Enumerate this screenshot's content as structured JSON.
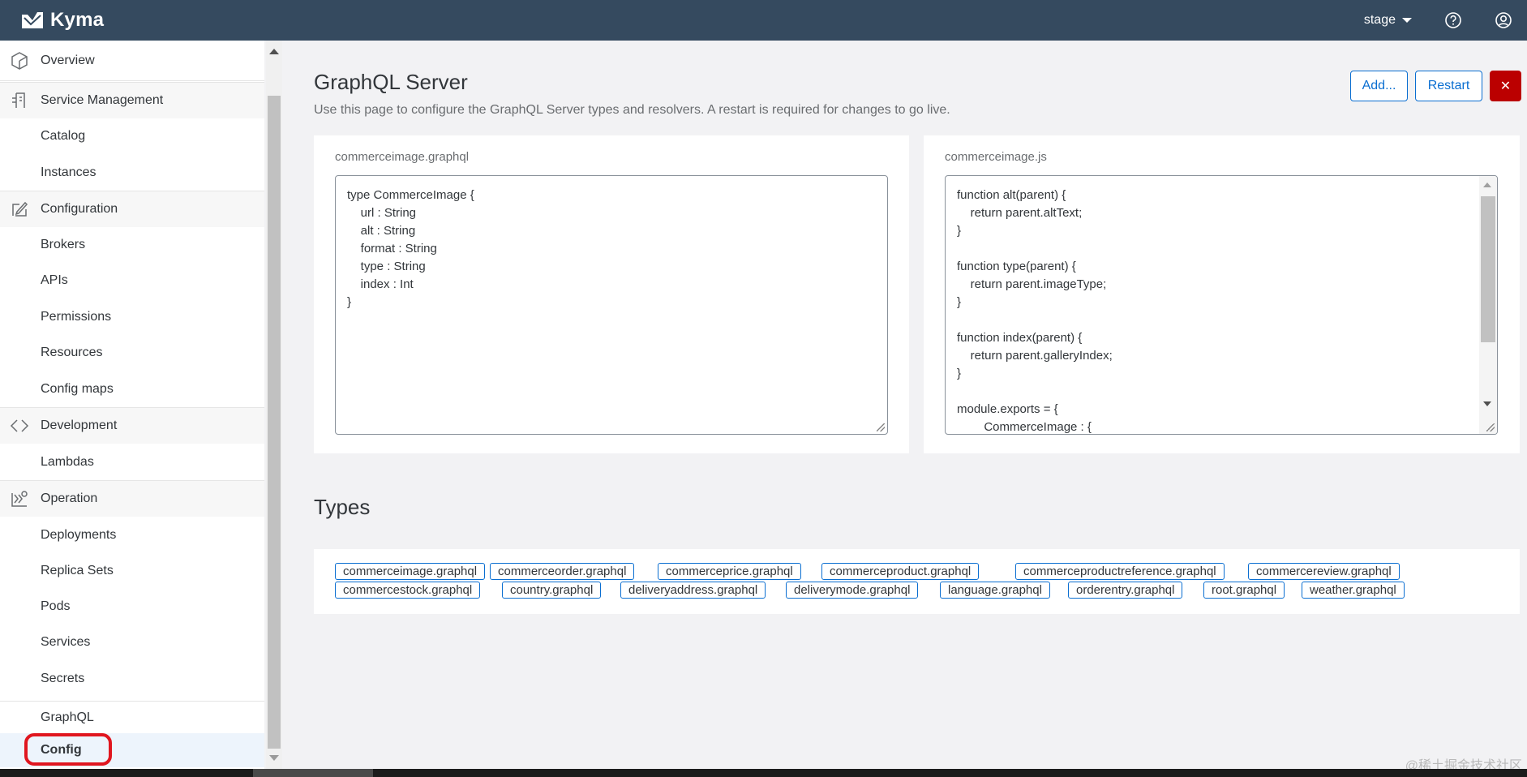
{
  "shell": {
    "app_title": "Kyma",
    "environment": "stage"
  },
  "sidebar": {
    "items": [
      {
        "label": "Overview",
        "kind": "section",
        "icon": "overview-icon"
      },
      {
        "label": "Service Management",
        "kind": "section",
        "icon": "service-management-icon"
      },
      {
        "label": "Catalog",
        "kind": "sub"
      },
      {
        "label": "Instances",
        "kind": "sub"
      },
      {
        "label": "Configuration",
        "kind": "section",
        "icon": "configuration-icon"
      },
      {
        "label": "Brokers",
        "kind": "sub"
      },
      {
        "label": "APIs",
        "kind": "sub"
      },
      {
        "label": "Permissions",
        "kind": "sub"
      },
      {
        "label": "Resources",
        "kind": "sub"
      },
      {
        "label": "Config maps",
        "kind": "sub"
      },
      {
        "label": "Development",
        "kind": "section",
        "icon": "development-icon"
      },
      {
        "label": "Lambdas",
        "kind": "sub"
      },
      {
        "label": "Operation",
        "kind": "section",
        "icon": "operation-icon"
      },
      {
        "label": "Deployments",
        "kind": "sub"
      },
      {
        "label": "Replica Sets",
        "kind": "sub"
      },
      {
        "label": "Pods",
        "kind": "sub"
      },
      {
        "label": "Services",
        "kind": "sub"
      },
      {
        "label": "Secrets",
        "kind": "sub"
      },
      {
        "label": "GraphQL",
        "kind": "section"
      },
      {
        "label": "Config",
        "kind": "sub",
        "active": true
      }
    ]
  },
  "page": {
    "title": "GraphQL Server",
    "description": "Use this page to configure the GraphQL Server types and resolvers. A restart is required for changes to go live.",
    "add_label": "Add...",
    "restart_label": "Restart",
    "close_label": "✕"
  },
  "schema_editor": {
    "filename": "commerceimage.graphql",
    "lines": [
      "type CommerceImage {",
      "    url : String",
      "    alt : String",
      "    format : String",
      "    type : String",
      "    index : Int",
      "}"
    ]
  },
  "resolver_editor": {
    "filename": "commerceimage.js",
    "lines": [
      "function alt(parent) {",
      "    return parent.altText;",
      "}",
      "",
      "function type(parent) {",
      "    return parent.imageType;",
      "}",
      "",
      "function index(parent) {",
      "    return parent.galleryIndex;",
      "}",
      "",
      "module.exports = {",
      "        CommerceImage : {"
    ]
  },
  "types": {
    "title": "Types",
    "row1": [
      "commerceimage.graphql",
      "commerceorder.graphql",
      "commerceprice.graphql",
      "commerceproduct.graphql",
      "commerceproductreference.graphql",
      "commercereview.graphql"
    ],
    "row2": [
      "commercestock.graphql",
      "country.graphql",
      "deliveryaddress.graphql",
      "deliverymode.graphql",
      "language.graphql",
      "orderentry.graphql",
      "root.graphql",
      "weather.graphql"
    ]
  },
  "watermark": "@稀土掘金技术社区",
  "colors": {
    "shellbar": "#354a5f",
    "accent": "#0a6ed1",
    "danger": "#bb0000",
    "highlight": "#e0161f"
  }
}
